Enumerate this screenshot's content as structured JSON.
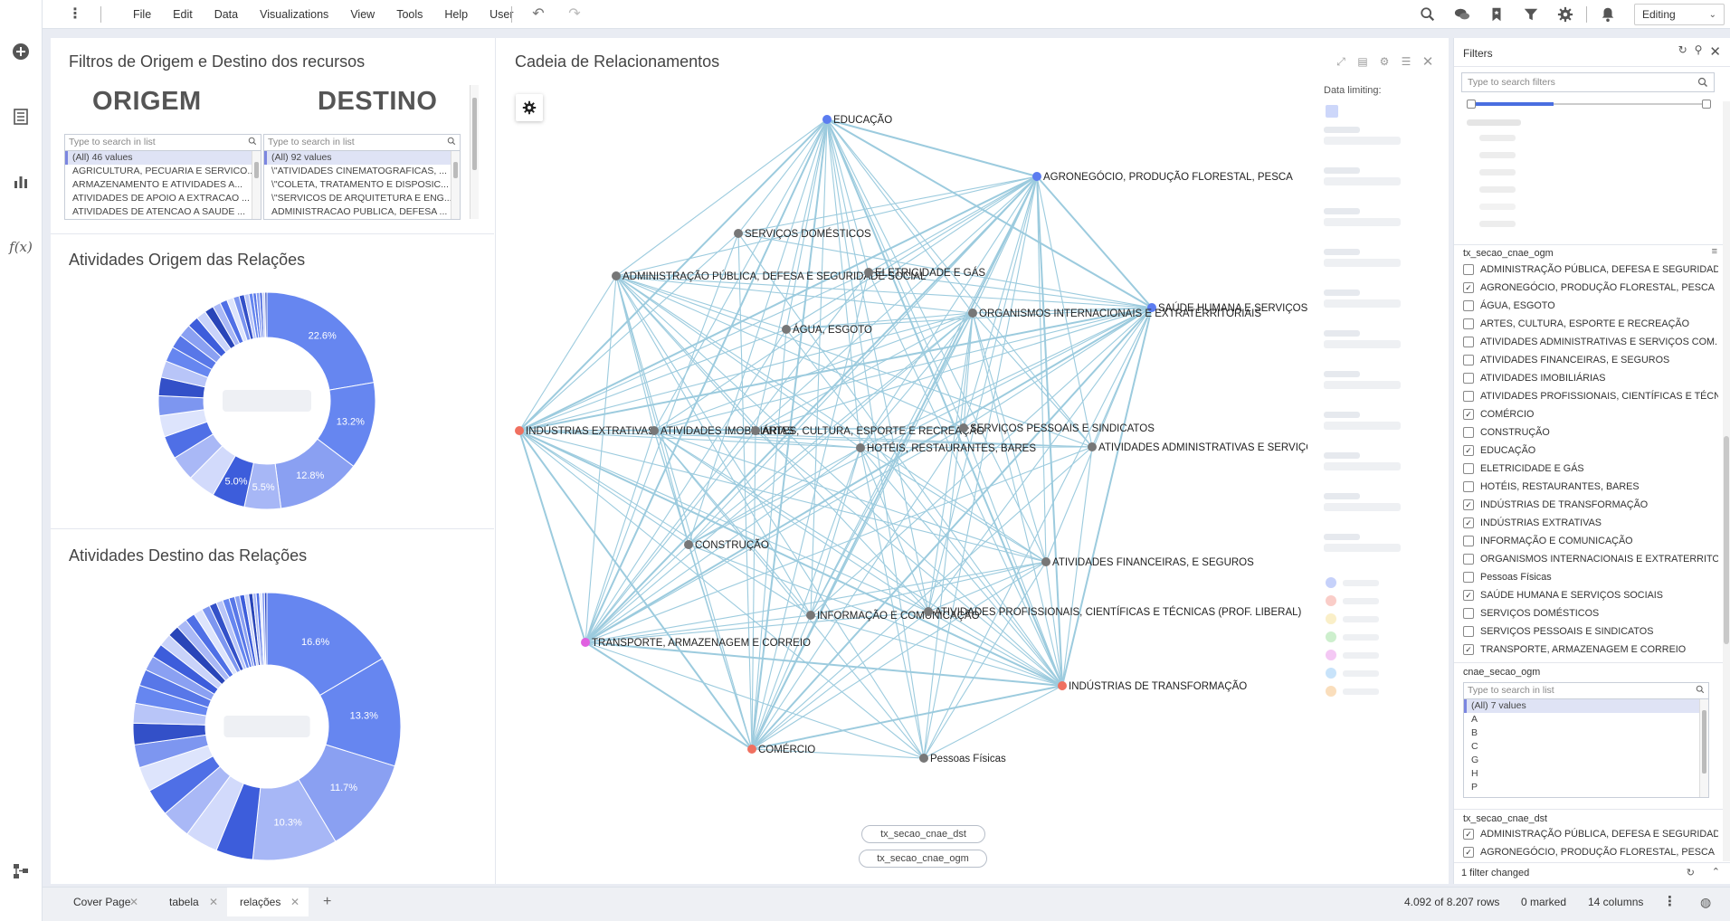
{
  "menubar": {
    "items": [
      "File",
      "Edit",
      "Data",
      "Visualizations",
      "View",
      "Tools",
      "Help",
      "User"
    ],
    "mode": "Editing"
  },
  "filter_panel_viz": {
    "title": "Filtros de Origem e Destino dos recursos",
    "origem_label": "ORIGEM",
    "destino_label": "DESTINO",
    "origem_search": "Type to search in list",
    "destino_search": "Type to search in list",
    "origem_items": [
      "(All) 46 values",
      "AGRICULTURA, PECUARIA E SERVICO...",
      "ARMAZENAMENTO E ATIVIDADES A...",
      "ATIVIDADES DE APOIO A EXTRACAO ...",
      "ATIVIDADES DE ATENCAO A SAUDE ..."
    ],
    "destino_items": [
      "(All) 92 values",
      "\\\"ATIVIDADES CINEMATOGRAFICAS, ...",
      "\\\"COLETA, TRATAMENTO E DISPOSIC...",
      "\\\"SERVICOS DE ARQUITETURA E ENG...",
      "ADMINISTRACAO PUBLICA, DEFESA ..."
    ]
  },
  "donut_origem": {
    "title": "Atividades Origem das Relações",
    "labels": [
      "22.6%",
      "13.2%",
      "12.8%",
      "5.5%",
      "5.0%"
    ]
  },
  "donut_destino": {
    "title": "Atividades Destino das Relações",
    "labels": [
      "16.6%",
      "13.3%",
      "11.7%",
      "10.3%"
    ]
  },
  "network": {
    "title": "Cadeia de Relacionamentos",
    "data_limiting": "Data limiting:",
    "pill_dst": "tx_secao_cnae_dst",
    "pill_ogm": "tx_secao_cnae_ogm",
    "nodes": [
      {
        "label": "EDUCAÇÃO",
        "color": "#5b7cf0"
      },
      {
        "label": "AGRONEGÓCIO, PRODUÇÃO FLORESTAL, PESCA",
        "color": "#5b7cf0"
      },
      {
        "label": "SERVIÇOS DOMÉSTICOS",
        "color": "#777777"
      },
      {
        "label": "ADMINISTRAÇÃO PÚBLICA, DEFESA E SEGURIDADE SOCIAL",
        "color": "#777777"
      },
      {
        "label": "ELETRICIDADE E GÁS",
        "color": "#777777"
      },
      {
        "label": "SAÚDE HUMANA E SERVIÇOS SOCIAIS",
        "color": "#5b7cf0"
      },
      {
        "label": "ORGANISMOS INTERNACIONAIS E EXTRATERRITORIAIS",
        "color": "#777777"
      },
      {
        "label": "ÁGUA, ESGOTO",
        "color": "#777777"
      },
      {
        "label": "INDÚSTRIAS EXTRATIVAS",
        "color": "#f07060"
      },
      {
        "label": "ATIVIDADES IMOBILIÁRIAS",
        "color": "#777777"
      },
      {
        "label": "ARTES, CULTURA, ESPORTE E RECREAÇÃO",
        "color": "#777777"
      },
      {
        "label": "SERVIÇOS PESSOAIS E SINDICATOS",
        "color": "#777777"
      },
      {
        "label": "HOTÉIS, RESTAURANTES, BARES",
        "color": "#777777"
      },
      {
        "label": "ATIVIDADES ADMINISTRATIVAS E SERVIÇOS COMPLEMENTARES",
        "color": "#777777"
      },
      {
        "label": "CONSTRUÇÃO",
        "color": "#777777"
      },
      {
        "label": "ATIVIDADES FINANCEIRAS, E SEGUROS",
        "color": "#777777"
      },
      {
        "label": "INFORMAÇÃO E COMUNICAÇÃO",
        "color": "#777777"
      },
      {
        "label": "ATIVIDADES PROFISSIONAIS, CIENTÍFICAS E TÉCNICAS (PROF. LIBERAL)",
        "color": "#777777"
      },
      {
        "label": "TRANSPORTE, ARMAZENAGEM E CORREIO",
        "color": "#e060e0"
      },
      {
        "label": "INDÚSTRIAS DE TRANSFORMAÇÃO",
        "color": "#f07060"
      },
      {
        "label": "COMÉRCIO",
        "color": "#f07060"
      },
      {
        "label": "Pessoas Físicas",
        "color": "#777777"
      }
    ]
  },
  "filters": {
    "title": "Filters",
    "search_placeholder": "Type to search filters",
    "group1": {
      "title": "tx_secao_cnae_ogm",
      "items": [
        {
          "label": "ADMINISTRAÇÃO PÚBLICA, DEFESA E SEGURIDAD...",
          "checked": false
        },
        {
          "label": "AGRONEGÓCIO, PRODUÇÃO FLORESTAL, PESCA",
          "checked": true
        },
        {
          "label": "ÁGUA, ESGOTO",
          "checked": false
        },
        {
          "label": "ARTES, CULTURA, ESPORTE E RECREAÇÃO",
          "checked": false
        },
        {
          "label": "ATIVIDADES ADMINISTRATIVAS E SERVIÇOS COM...",
          "checked": false
        },
        {
          "label": "ATIVIDADES FINANCEIRAS, E SEGUROS",
          "checked": false
        },
        {
          "label": "ATIVIDADES IMOBILIÁRIAS",
          "checked": false
        },
        {
          "label": "ATIVIDADES PROFISSIONAIS, CIENTÍFICAS E TÉCN...",
          "checked": false
        },
        {
          "label": "COMÉRCIO",
          "checked": true
        },
        {
          "label": "CONSTRUÇÃO",
          "checked": false
        },
        {
          "label": "EDUCAÇÃO",
          "checked": true
        },
        {
          "label": "ELETRICIDADE E GÁS",
          "checked": false
        },
        {
          "label": "HOTÉIS, RESTAURANTES, BARES",
          "checked": false
        },
        {
          "label": "INDÚSTRIAS DE TRANSFORMAÇÃO",
          "checked": true
        },
        {
          "label": "INDÚSTRIAS EXTRATIVAS",
          "checked": true
        },
        {
          "label": "INFORMAÇÃO E COMUNICAÇÃO",
          "checked": false
        },
        {
          "label": "ORGANISMOS INTERNACIONAIS E EXTRATERRITO...",
          "checked": false
        },
        {
          "label": "Pessoas Físicas",
          "checked": false
        },
        {
          "label": "SAÚDE HUMANA E SERVIÇOS SOCIAIS",
          "checked": true
        },
        {
          "label": "SERVIÇOS DOMÉSTICOS",
          "checked": false
        },
        {
          "label": "SERVIÇOS PESSOAIS E SINDICATOS",
          "checked": false
        },
        {
          "label": "TRANSPORTE, ARMAZENAGEM E CORREIO",
          "checked": true
        }
      ]
    },
    "group2": {
      "title": "cnae_secao_ogm",
      "search": "Type to search in list",
      "items": [
        "(All) 7 values",
        "A",
        "B",
        "C",
        "G",
        "H",
        "P"
      ]
    },
    "group3": {
      "title": "tx_secao_cnae_dst",
      "items": [
        {
          "label": "ADMINISTRAÇÃO PÚBLICA, DEFESA E SEGURIDAD...",
          "checked": true
        },
        {
          "label": "AGRONEGÓCIO, PRODUÇÃO FLORESTAL, PESCA",
          "checked": true
        }
      ]
    },
    "footer": "1 filter changed"
  },
  "tabs": [
    {
      "label": "Cover Page",
      "active": false
    },
    {
      "label": "tabela",
      "active": false
    },
    {
      "label": "relações",
      "active": true
    }
  ],
  "status": {
    "rows": "4.092 of 8.207 rows",
    "marked": "0 marked",
    "columns": "14 columns"
  }
}
